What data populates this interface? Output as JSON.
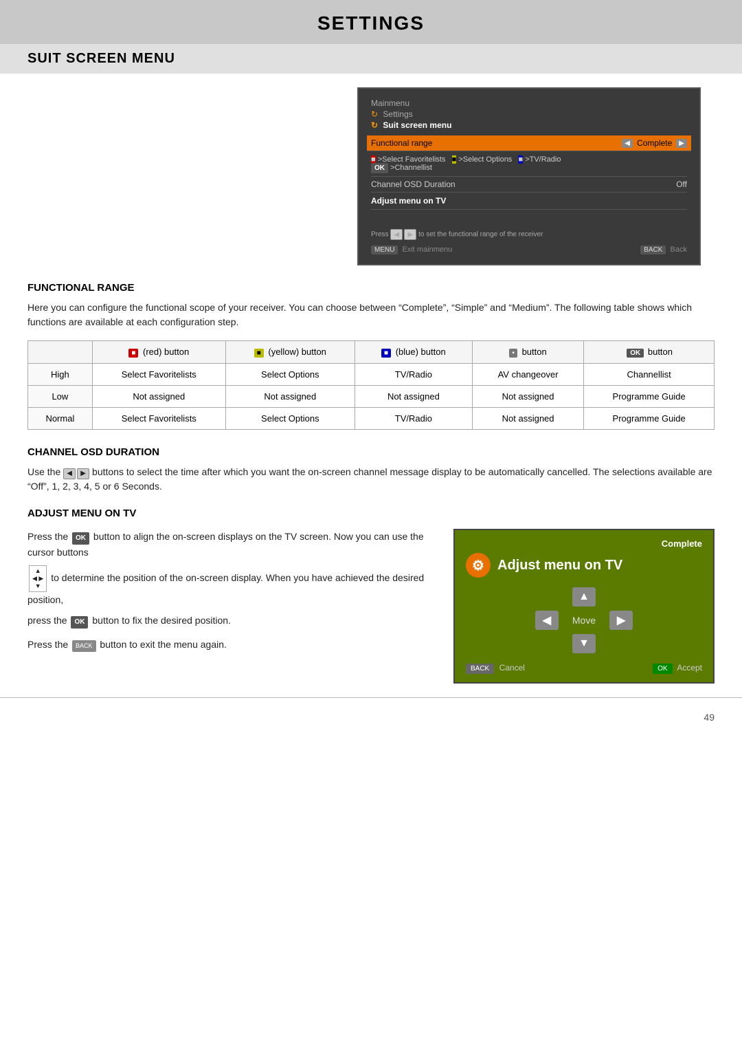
{
  "page": {
    "title": "SETTINGS",
    "section": "SUIT SCREEN MENU",
    "page_number": "49"
  },
  "tv_screen": {
    "menu_path_1": "Mainmenu",
    "menu_path_2": "Settings",
    "menu_path_3": "Suit screen menu",
    "functional_range_label": "Functional range",
    "functional_range_value": "Complete",
    "btn_row": ">Select Favoritelists  >Select Options  >TV/Radio",
    "btn_row2": ">Channellist",
    "channel_osd_label": "Channel OSD Duration",
    "channel_osd_value": "Off",
    "adjust_menu_label": "Adjust menu on TV",
    "hint": "Press  to set the functional range of the receiver",
    "exit_label": "Exit mainmenu",
    "back_label": "Back"
  },
  "functional_range": {
    "title": "FUNCTIONAL RANGE",
    "body": "Here you can configure the functional scope of your receiver. You can choose between “Complete”, “Simple” and “Medium”. The following table shows which functions are available at each configuration step.",
    "table": {
      "headers": [
        "",
        "(red) button",
        "(yellow) button",
        "(blue) button",
        "button",
        "button"
      ],
      "rows": [
        {
          "label": "High",
          "col1": "Select Favoritelists",
          "col2": "Select Options",
          "col3": "TV/Radio",
          "col4": "AV changeover",
          "col5": "Channellist"
        },
        {
          "label": "Low",
          "col1": "Not assigned",
          "col2": "Not assigned",
          "col3": "Not assigned",
          "col4": "Not assigned",
          "col5": "Programme Guide"
        },
        {
          "label": "Normal",
          "col1": "Select Favoritelists",
          "col2": "Select Options",
          "col3": "TV/Radio",
          "col4": "Not assigned",
          "col5": "Programme Guide"
        }
      ]
    }
  },
  "channel_osd": {
    "title": "CHANNEL OSD DURATION",
    "body": "Use the  buttons to select the time after which you want the on-screen channel message display to be automatically cancelled. The selections available are “Off”, 1, 2, 3, 4, 5 or 6 Seconds."
  },
  "adjust_menu": {
    "title": "ADJUST MENU ON TV",
    "para1": "button to align the on-screen displays on the TV screen. Now you can use the cursor buttons",
    "para2": "to determine the position of the on-screen display. When you have achieved the desired position,",
    "para3": "button to fix the desired position.",
    "para4": "button to exit the menu again.",
    "press_ok_label": "Press the",
    "press_back_label": "Press the",
    "tv_title": "Adjust menu on TV",
    "move_label": "Move",
    "cancel_label": "Cancel",
    "accept_label": "Accept",
    "complete_label": "Complete"
  }
}
